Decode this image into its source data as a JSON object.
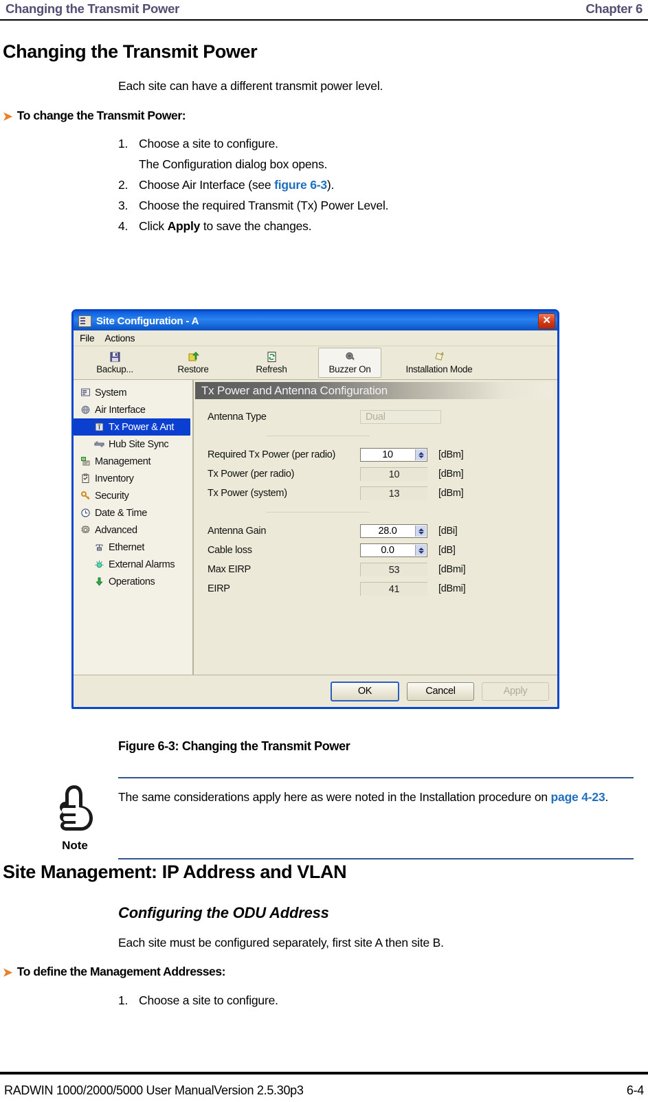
{
  "running_head": {
    "left": "Changing the Transmit Power",
    "right": "Chapter 6",
    "color": "#524f72"
  },
  "section": {
    "title": "Changing the Transmit Power",
    "intro": "Each site can have a different transmit power level.",
    "procedure_heading": "To change the Transmit Power:",
    "steps": [
      {
        "num": "1.",
        "text": "Choose a site to configure."
      },
      {
        "num": "2.",
        "pre": "Choose Air Interface (see ",
        "link": "figure 6-3",
        "post": ")."
      },
      {
        "num": "3.",
        "text": "Choose the required Transmit (Tx) Power Level."
      },
      {
        "num": "4.",
        "pre": "Click ",
        "bold": "Apply",
        "post": " to save the changes."
      }
    ],
    "substep": "The Configuration dialog box opens."
  },
  "figure": {
    "caption": "Figure 6-3: Changing the Transmit Power",
    "window": {
      "title": "Site Configuration - A",
      "title_icon": "site-config-icon",
      "close_label": "✕",
      "menus": [
        "File",
        "Actions"
      ],
      "toolbar": [
        {
          "label": "Backup...",
          "icon": "save-disk-icon",
          "pressed": false
        },
        {
          "label": "Restore",
          "icon": "restore-up-arrow-icon",
          "pressed": false
        },
        {
          "label": "Refresh",
          "icon": "refresh-page-icon",
          "pressed": false
        },
        {
          "label": "Buzzer On",
          "icon": "buzzer-speaker-icon",
          "pressed": true
        },
        {
          "label": "Installation Mode",
          "icon": "installation-mode-icon",
          "pressed": false
        }
      ],
      "tree": [
        {
          "label": "System",
          "icon": "system-icon",
          "indent": false,
          "selected": false
        },
        {
          "label": "Air Interface",
          "icon": "air-interface-globe-icon",
          "indent": false,
          "selected": false
        },
        {
          "label": "Tx Power & Ant",
          "icon": "tx-power-antenna-icon",
          "indent": true,
          "selected": true
        },
        {
          "label": "Hub Site Sync",
          "icon": "hub-site-sync-icon",
          "indent": true,
          "selected": false
        },
        {
          "label": "Management",
          "icon": "management-icon",
          "indent": false,
          "selected": false
        },
        {
          "label": "Inventory",
          "icon": "inventory-clipboard-icon",
          "indent": false,
          "selected": false
        },
        {
          "label": "Security",
          "icon": "security-key-icon",
          "indent": false,
          "selected": false
        },
        {
          "label": "Date & Time",
          "icon": "clock-icon",
          "indent": false,
          "selected": false
        },
        {
          "label": "Advanced",
          "icon": "advanced-gear-icon",
          "indent": false,
          "selected": false
        },
        {
          "label": "Ethernet",
          "icon": "ethernet-icon",
          "indent": true,
          "selected": false
        },
        {
          "label": "External Alarms",
          "icon": "external-alarms-icon",
          "indent": true,
          "selected": false
        },
        {
          "label": "Operations",
          "icon": "operations-down-arrow-icon",
          "indent": true,
          "selected": false
        }
      ],
      "panel_title": "Tx Power and Antenna Configuration",
      "fields": [
        {
          "label": "Antenna Type",
          "value": "Dual",
          "unit": "",
          "kind": "disabled"
        },
        {
          "label": "Required Tx Power (per radio)",
          "value": "10",
          "unit": "[dBm]",
          "kind": "spinner"
        },
        {
          "label": "Tx Power (per radio)",
          "value": "10",
          "unit": "[dBm]",
          "kind": "readonly"
        },
        {
          "label": "Tx Power (system)",
          "value": "13",
          "unit": "[dBm]",
          "kind": "readonly"
        },
        {
          "label": "Antenna Gain",
          "value": "28.0",
          "unit": "[dBi]",
          "kind": "spinner"
        },
        {
          "label": "Cable loss",
          "value": "0.0",
          "unit": "[dB]",
          "kind": "spinner"
        },
        {
          "label": "Max EIRP",
          "value": "53",
          "unit": "[dBmi]",
          "kind": "readonly"
        },
        {
          "label": "EIRP",
          "value": "41",
          "unit": "[dBmi]",
          "kind": "readonly"
        }
      ],
      "buttons": [
        {
          "label": "OK",
          "state": "default"
        },
        {
          "label": "Cancel",
          "state": "normal"
        },
        {
          "label": "Apply",
          "state": "disabled"
        }
      ]
    }
  },
  "note": {
    "icon": "pointing-hand-icon",
    "label": "Note",
    "text_pre": "The same considerations apply here as were noted in the Installation procedure on ",
    "link": "page 4-23",
    "text_post": ".",
    "rule_color": "#31568f"
  },
  "section2": {
    "title": "Site Management: IP Address and VLAN",
    "subtitle": "Configuring the ODU Address",
    "intro": "Each site must be configured separately, first site A then site B.",
    "procedure_heading": "To define the Management Addresses:",
    "steps": [
      {
        "num": "1.",
        "text": "Choose a site to configure."
      }
    ]
  },
  "footer": {
    "left": "RADWIN 1000/2000/5000 User ManualVersion  2.5.30p3",
    "right": "6-4"
  }
}
